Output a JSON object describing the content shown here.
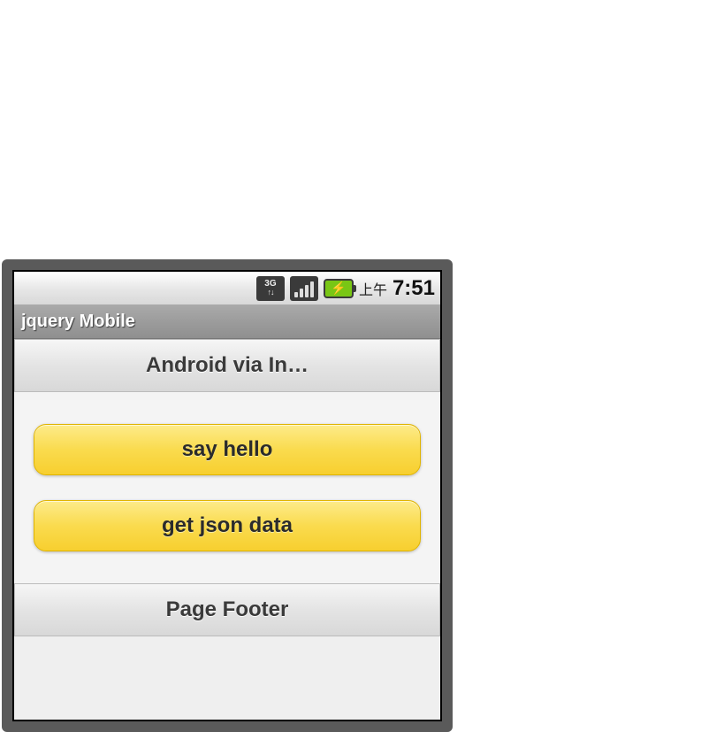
{
  "statusbar": {
    "network_icon": "3G",
    "ampm": "上午",
    "time": "7:51"
  },
  "window": {
    "title": "jquery Mobile"
  },
  "page": {
    "header": "Android via In…",
    "footer": "Page Footer"
  },
  "buttons": {
    "say_hello": "say hello",
    "get_json": "get json data"
  }
}
